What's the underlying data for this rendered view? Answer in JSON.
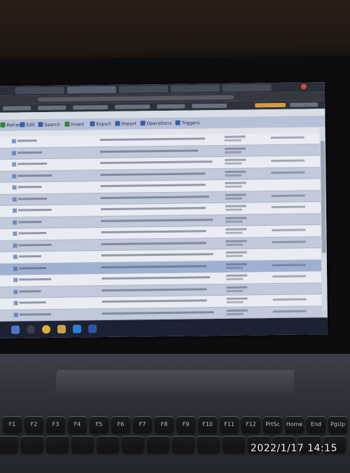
{
  "toolbar": {
    "items": [
      {
        "label": "Refresh",
        "icon": "refresh-icon",
        "color": "#3c7d3a"
      },
      {
        "label": "Edit",
        "icon": "edit-icon",
        "color": "#3a5ea8"
      },
      {
        "label": "Search",
        "icon": "search-icon",
        "color": "#3a5ea8"
      },
      {
        "label": "Insert",
        "icon": "insert-icon",
        "color": "#3c7d3a"
      },
      {
        "label": "Export",
        "icon": "export-icon",
        "color": "#3a5ea8"
      },
      {
        "label": "Import",
        "icon": "import-icon",
        "color": "#3a5ea8"
      },
      {
        "label": "Operations",
        "icon": "operations-icon",
        "color": "#3a5ea8"
      },
      {
        "label": "Triggers",
        "icon": "triggers-icon",
        "color": "#3a5ea8"
      }
    ]
  },
  "timestamp": "2022/1/17  14:15",
  "colors": {
    "row_light": "#e9ecf2",
    "row_dark": "#c1c9da",
    "row_highlight": "#9fb0d2",
    "accent": "#3a5ea8"
  },
  "taskbar_icons": [
    "start-icon",
    "search-icon",
    "chrome-icon",
    "explorer-icon",
    "vscode-icon",
    "word-icon"
  ],
  "keyboard_keys": [
    "F1",
    "F2",
    "F3",
    "F4",
    "F5",
    "F6",
    "F7",
    "F8",
    "F9",
    "F10",
    "F11",
    "F12",
    "PrtSc",
    "Home",
    "End",
    "PgUp"
  ]
}
